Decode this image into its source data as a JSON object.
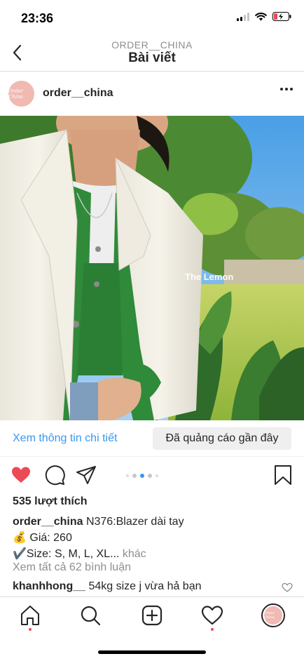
{
  "status_bar": {
    "time": "23:36",
    "icons": [
      "signal-icon",
      "wifi-icon",
      "battery-charging-icon"
    ]
  },
  "header": {
    "subtitle": "ORDER__CHINA",
    "title": "Bài viết",
    "back_icon": "chevron-left-icon"
  },
  "post": {
    "avatar_text": "Order China",
    "username": "order__china",
    "image_watermark": "The Lemon",
    "cta_link": "Xem thông tin chi tiết",
    "cta_button": "Đã quảng cáo gần đây",
    "carousel": {
      "count": 5,
      "active_index": 2
    },
    "likes": "535 lượt thích",
    "caption": {
      "username": "order__china",
      "line1": "N376:Blazer dài tay",
      "line2": "💰 Giá: 260",
      "line3": "✔️Size: S, M, L, XL...",
      "more": "khác"
    },
    "view_comments": "Xem tất cả 62 bình luận",
    "comment": {
      "username": "khanhhong__",
      "text": "54kg size j vừa hả bạn"
    }
  },
  "tabbar": {
    "items": [
      "home-icon",
      "search-icon",
      "add-post-icon",
      "activity-heart-icon",
      "profile-avatar"
    ]
  },
  "colors": {
    "accent_blue": "#3897f0",
    "like_red": "#ed4956",
    "text": "#262626",
    "muted": "#8e8e8e"
  }
}
